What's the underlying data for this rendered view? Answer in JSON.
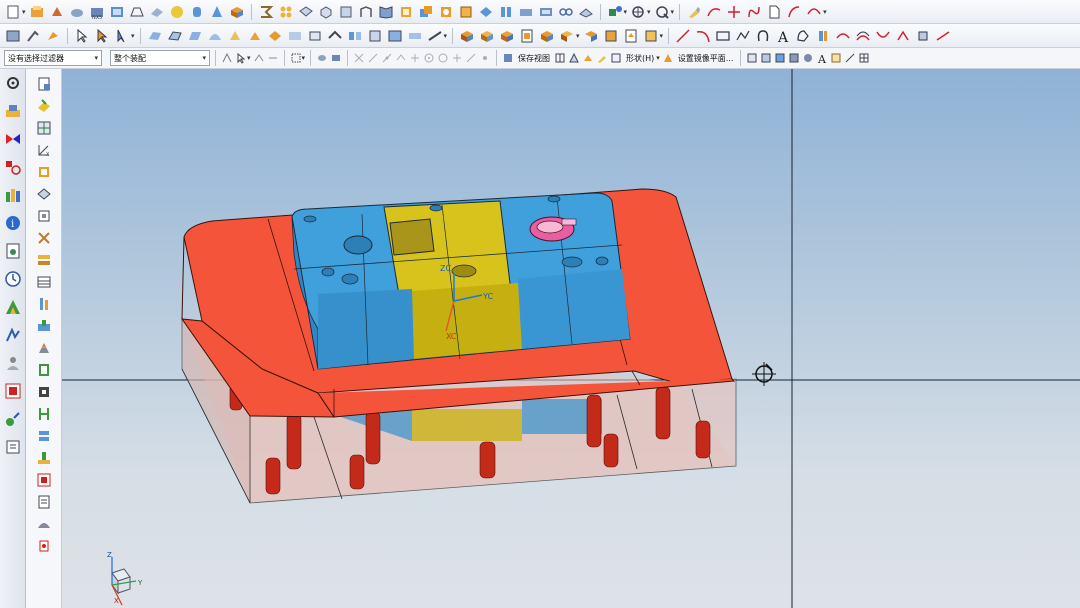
{
  "toolbar": {
    "selection_filter": "没有选择过滤器",
    "assembly_scope": "整个装配",
    "save_view_label": "保存视图",
    "shape_menu_label": "形状(H)",
    "mirror_plane_label": "设置镜像平面..."
  },
  "viewport": {
    "csys_x": "XC",
    "csys_y": "YC",
    "csys_z": "ZC",
    "triad_x": "X",
    "triad_y": "Y",
    "triad_z": "Z"
  },
  "colors": {
    "mold_red": "#f4553a",
    "core_blue": "#4aa8e0",
    "insert_yellow": "#d8c21c",
    "pin_red": "#c0281a",
    "highlight_pink": "#e95ea0"
  }
}
